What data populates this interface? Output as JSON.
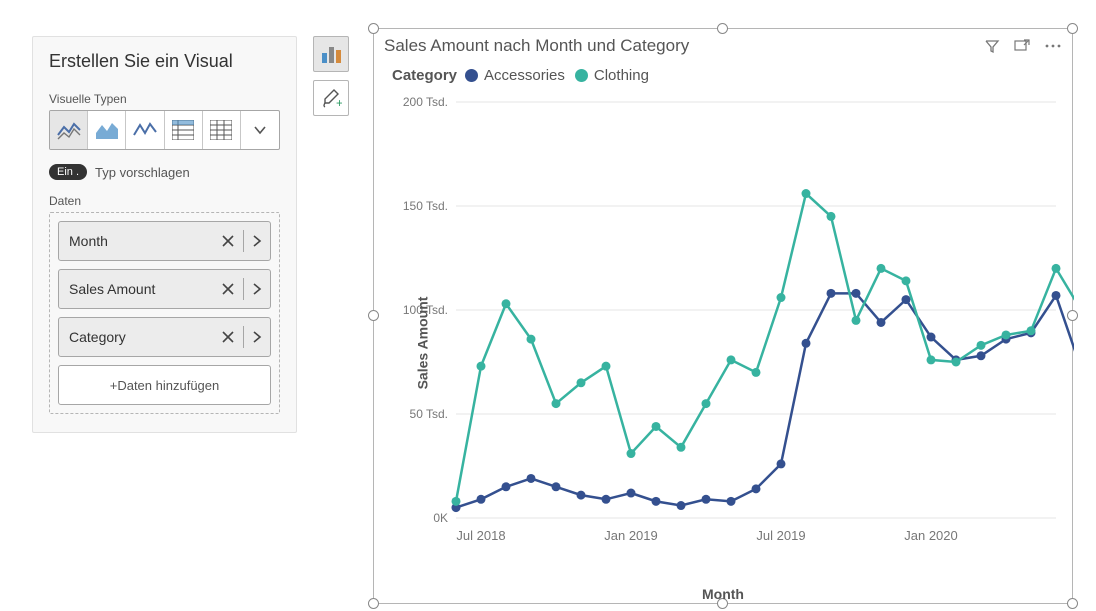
{
  "pane": {
    "title": "Erstellen Sie ein Visual",
    "types_label": "Visuelle Typen",
    "toggle_text": "Ein .",
    "suggest_text": "Typ vorschlagen",
    "data_label": "Daten",
    "fields": [
      {
        "label": "Month"
      },
      {
        "label": "Sales Amount"
      },
      {
        "label": "Category"
      }
    ],
    "add_data": "+Daten hinzufügen"
  },
  "visual": {
    "title": "Sales Amount nach Month und Category",
    "legend_label": "Category",
    "legend": [
      {
        "name": "Accessories",
        "color": "#34508f"
      },
      {
        "name": "Clothing",
        "color": "#37b3a0"
      }
    ]
  },
  "chart_data": {
    "type": "line",
    "title": "Sales Amount nach Month und Category",
    "xlabel": "Month",
    "ylabel": "Sales Amount",
    "ylim": [
      0,
      200
    ],
    "y_unit": "Tsd.",
    "y_ticks": [
      0,
      50,
      100,
      150,
      200
    ],
    "y_tick_labels": [
      "0K",
      "50 Tsd.",
      "100 Tsd.",
      "150 Tsd.",
      "200 Tsd."
    ],
    "x_tick_labels": [
      "Jul 2018",
      "Jan 2019",
      "Jul 2019",
      "Jan 2020"
    ],
    "x_tick_positions": [
      1,
      7,
      13,
      19
    ],
    "categories": [
      "Jun 2018",
      "Jul 2018",
      "Aug 2018",
      "Sep 2018",
      "Okt 2018",
      "Nov 2018",
      "Dez 2018",
      "Jan 2019",
      "Feb 2019",
      "Mar 2019",
      "Apr 2019",
      "Mai 2019",
      "Jun 2019",
      "Jul 2019",
      "Aug 2019",
      "Sep 2019",
      "Okt 2019",
      "Nov 2019",
      "Dez 2019",
      "Jan 2020",
      "Feb 2020",
      "Mar 2020",
      "Apr 2020",
      "Mai 2020",
      "Jun 2020"
    ],
    "series": [
      {
        "name": "Accessories",
        "color": "#34508f",
        "values": [
          5,
          9,
          15,
          19,
          15,
          11,
          9,
          12,
          8,
          6,
          9,
          8,
          14,
          26,
          84,
          108,
          108,
          94,
          105,
          87,
          76,
          78,
          86,
          89,
          107,
          72
        ]
      },
      {
        "name": "Clothing",
        "color": "#37b3a0",
        "values": [
          8,
          73,
          103,
          86,
          55,
          65,
          73,
          31,
          44,
          34,
          55,
          76,
          70,
          106,
          156,
          145,
          95,
          120,
          114,
          76,
          75,
          83,
          88,
          90,
          120,
          100
        ]
      }
    ]
  }
}
